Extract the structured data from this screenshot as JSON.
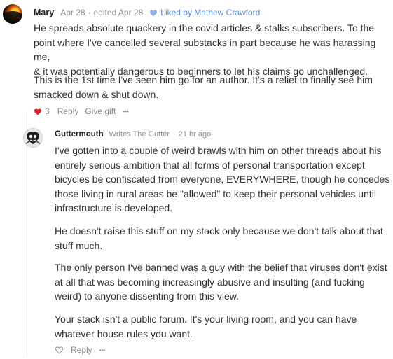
{
  "comment1": {
    "author": "Mary",
    "date": "Apr 28",
    "separator": "·",
    "edited": "edited Apr 28",
    "liked_by": "Liked by Mathew Crawford",
    "paragraphs": [
      [
        "He spreads absolute quackery in the covid articles & stalks subscribers. To the",
        "point where I've cancelled several substacks in part because he was harassing me,",
        "& it was potentially dangerous to beginners to let his claims go unchallenged."
      ],
      [
        "This is the 1st time I've seen him go for an author. It's a relief to finally see him",
        "smacked down & shut down."
      ]
    ],
    "like_count": "3",
    "reply_label": "Reply",
    "gift_label": "Give gift",
    "more_label": "•••"
  },
  "comment2": {
    "author": "Guttermouth",
    "writes": "Writes The Gutter",
    "separator": "·",
    "time": "21 hr ago",
    "paragraphs": [
      [
        "I've gotten into a couple of weird brawls with him on other threads about his",
        "entirely serious ambition that all forms of personal transportation except",
        "bicycles be confiscated from everyone, EVERYWHERE, though he concedes",
        "those living in rural areas be \"allowed\" to keep their personal vehicles until",
        "infrastructure is developed."
      ],
      [
        "He doesn't raise this stuff on my stack only because we don't talk about that",
        "stuff much."
      ],
      [
        "The only person I've banned was a guy with the belief that viruses don't exist",
        "at all that was becoming increasingly abusive and insulting (and fucking",
        "weird) to anyone dissenting from this view."
      ],
      [
        "Your stack isn't a public forum. It's your living room, and you can have",
        "whatever house rules you want."
      ]
    ],
    "reply_label": "Reply",
    "more_label": "•••"
  },
  "colors": {
    "accent_blue": "#5b8fd8",
    "heart_red": "#d8262d",
    "meta_gray": "#8a8a8a"
  },
  "icons": [
    "heart-filled-icon",
    "heart-outline-icon",
    "more-icon"
  ]
}
